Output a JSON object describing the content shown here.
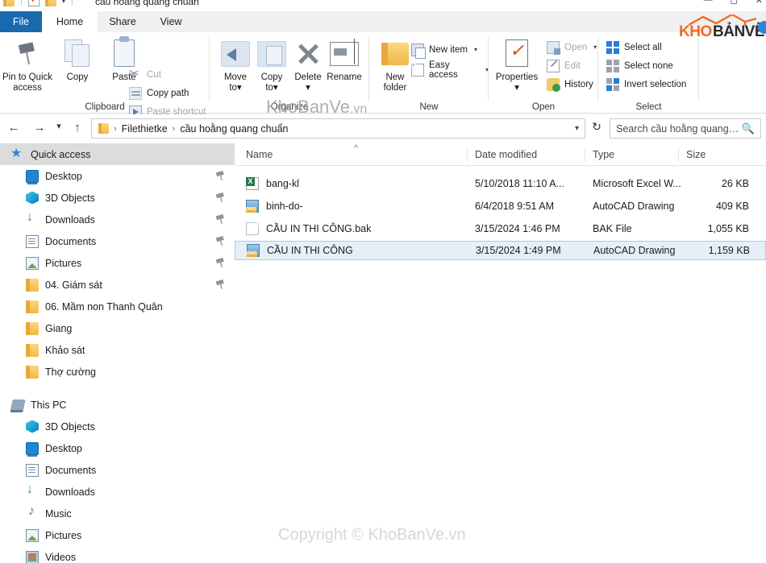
{
  "window": {
    "title": "cầu hoằng quang chuẩn",
    "quick_access_icons": [
      "folder-icon",
      "properties-icon",
      "new-folder-icon",
      "customize-caret-icon"
    ],
    "controls": [
      "minimize-icon",
      "maximize-icon",
      "close-icon"
    ]
  },
  "ribbon": {
    "tabs": [
      {
        "label": "File",
        "active": false,
        "accent": "#1869ae"
      },
      {
        "label": "Home",
        "active": true
      },
      {
        "label": "Share",
        "active": false
      },
      {
        "label": "View",
        "active": false
      }
    ],
    "groups": [
      {
        "name": "Clipboard",
        "label": "Clipboard",
        "big_buttons": [
          {
            "label_line1": "Pin to Quick",
            "label_line2": "access",
            "icon": "pin-icon"
          },
          {
            "label_line1": "Copy",
            "label_line2": "",
            "icon": "copy-icon"
          },
          {
            "label_line1": "Paste",
            "label_line2": "",
            "icon": "paste-icon"
          }
        ],
        "small_buttons": [
          {
            "label": "Cut",
            "icon": "scissors-icon"
          },
          {
            "label": "Copy path",
            "icon": "copy-path-icon"
          },
          {
            "label": "Paste shortcut",
            "icon": "paste-shortcut-icon"
          }
        ]
      },
      {
        "name": "Organize",
        "label": "Organize",
        "big_buttons": [
          {
            "label_line1": "Move",
            "label_line2": "to",
            "icon": "move-to-icon",
            "dropdown": true
          },
          {
            "label_line1": "Copy",
            "label_line2": "to",
            "icon": "copy-to-icon",
            "dropdown": true
          },
          {
            "label_line1": "Delete",
            "label_line2": "",
            "icon": "delete-x-icon",
            "dropdown": true
          },
          {
            "label_line1": "Rename",
            "label_line2": "",
            "icon": "rename-icon"
          }
        ],
        "small_buttons": []
      },
      {
        "name": "New",
        "label": "New",
        "big_buttons": [
          {
            "label_line1": "New",
            "label_line2": "folder",
            "icon": "new-folder-icon"
          }
        ],
        "small_buttons": [
          {
            "label": "New item",
            "icon": "new-item-icon",
            "dropdown": true
          },
          {
            "label": "Easy access",
            "icon": "easy-access-icon",
            "dropdown": true
          }
        ]
      },
      {
        "name": "Open",
        "label": "Open",
        "big_buttons": [
          {
            "label_line1": "Properties",
            "label_line2": "",
            "icon": "properties-icon",
            "dropdown": true
          }
        ],
        "small_buttons": [
          {
            "label": "Open",
            "icon": "open-icon",
            "dropdown": true
          },
          {
            "label": "Edit",
            "icon": "edit-icon"
          },
          {
            "label": "History",
            "icon": "history-icon"
          }
        ]
      },
      {
        "name": "Select",
        "label": "Select",
        "big_buttons": [],
        "small_buttons": [
          {
            "label": "Select all",
            "icon": "select-all-icon"
          },
          {
            "label": "Select none",
            "icon": "select-none-icon"
          },
          {
            "label": "Invert selection",
            "icon": "invert-selection-icon"
          }
        ]
      }
    ]
  },
  "addressbar": {
    "back_icon": "arrow-left-icon",
    "forward_icon": "arrow-right-icon",
    "recent_icon": "chevron-down-icon",
    "up_icon": "arrow-up-icon",
    "breadcrumb": [
      "Filethietke",
      "cầu hoằng quang chuẩn"
    ],
    "dropdown_icon": "chevron-down-icon",
    "refresh_icon": "refresh-icon",
    "search_placeholder": "Search cầu hoằng quang c...",
    "search_value": "",
    "search_icon": "search-icon"
  },
  "sidebar": {
    "items": [
      {
        "label": "Quick access",
        "icon": "star-icon",
        "level": 0,
        "selected": true,
        "pinned": false
      },
      {
        "label": "Desktop",
        "icon": "desktop-icon",
        "level": 1,
        "selected": false,
        "pinned": true
      },
      {
        "label": "3D Objects",
        "icon": "3d-objects-icon",
        "level": 1,
        "selected": false,
        "pinned": true
      },
      {
        "label": "Downloads",
        "icon": "downloads-icon",
        "level": 1,
        "selected": false,
        "pinned": true
      },
      {
        "label": "Documents",
        "icon": "documents-icon",
        "level": 1,
        "selected": false,
        "pinned": true
      },
      {
        "label": "Pictures",
        "icon": "pictures-icon",
        "level": 1,
        "selected": false,
        "pinned": true
      },
      {
        "label": "04. Giám sát",
        "icon": "folder-icon",
        "level": 1,
        "selected": false,
        "pinned": true
      },
      {
        "label": "06. Mầm non Thanh Quân",
        "icon": "folder-icon",
        "level": 1,
        "selected": false,
        "pinned": false
      },
      {
        "label": "Giang",
        "icon": "folder-icon",
        "level": 1,
        "selected": false,
        "pinned": false
      },
      {
        "label": "Khảo sát",
        "icon": "folder-icon",
        "level": 1,
        "selected": false,
        "pinned": false
      },
      {
        "label": "Thợ cường",
        "icon": "folder-icon",
        "level": 1,
        "selected": false,
        "pinned": false
      },
      {
        "label": "This PC",
        "icon": "this-pc-icon",
        "level": 0,
        "selected": false,
        "pinned": false
      },
      {
        "label": "3D Objects",
        "icon": "3d-objects-icon",
        "level": 1,
        "selected": false,
        "pinned": false
      },
      {
        "label": "Desktop",
        "icon": "desktop-icon",
        "level": 1,
        "selected": false,
        "pinned": false
      },
      {
        "label": "Documents",
        "icon": "documents-icon",
        "level": 1,
        "selected": false,
        "pinned": false
      },
      {
        "label": "Downloads",
        "icon": "downloads-icon",
        "level": 1,
        "selected": false,
        "pinned": false
      },
      {
        "label": "Music",
        "icon": "music-icon",
        "level": 1,
        "selected": false,
        "pinned": false
      },
      {
        "label": "Pictures",
        "icon": "pictures-icon",
        "level": 1,
        "selected": false,
        "pinned": false
      },
      {
        "label": "Videos",
        "icon": "videos-icon",
        "level": 1,
        "selected": false,
        "pinned": false
      }
    ]
  },
  "filelist": {
    "columns": [
      {
        "label": "Name",
        "sorted": "asc"
      },
      {
        "label": "Date modified",
        "sorted": ""
      },
      {
        "label": "Type",
        "sorted": ""
      },
      {
        "label": "Size",
        "sorted": ""
      }
    ],
    "sort_indicator_icon": "chevron-up-icon",
    "rows": [
      {
        "name": "bang-kl",
        "date_modified": "5/10/2018 11:10 A...",
        "type": "Microsoft Excel W...",
        "size": "26 KB",
        "icon": "excel-file-icon",
        "selected": false
      },
      {
        "name": "binh-do-",
        "date_modified": "6/4/2018 9:51 AM",
        "type": "AutoCAD Drawing",
        "size": "409 KB",
        "icon": "autocad-dwg-icon",
        "selected": false
      },
      {
        "name": "CẦU IN THI CÔNG.bak",
        "date_modified": "3/15/2024 1:46 PM",
        "type": "BAK File",
        "size": "1,055 KB",
        "icon": "bak-file-icon",
        "selected": false
      },
      {
        "name": "CẦU IN THI CÔNG",
        "date_modified": "3/15/2024 1:49 PM",
        "type": "AutoCAD Drawing",
        "size": "1,159 KB",
        "icon": "autocad-dwg-icon",
        "selected": true
      }
    ]
  },
  "watermarks": {
    "ribbon_text": "KhoBanVe",
    "ribbon_suffix": ".vn",
    "bottom_text": "Copyright © KhoBanVe.vn",
    "logo_first": "KHO",
    "logo_second": "BẢNVẼ",
    "logo_accent": "#f06c24"
  }
}
